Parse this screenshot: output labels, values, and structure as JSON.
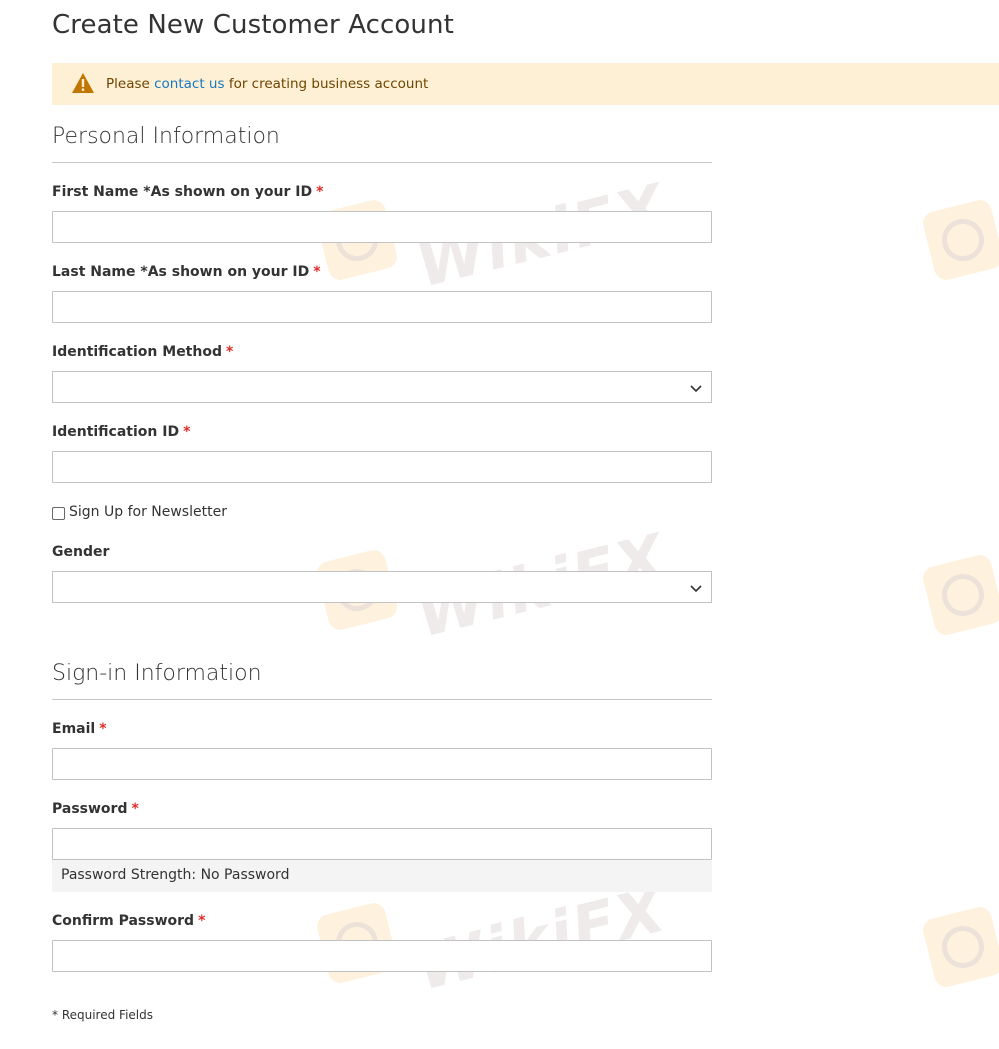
{
  "page": {
    "title": "Create New Customer Account"
  },
  "notice": {
    "prefix": "Please",
    "link": "contact us",
    "suffix": "for creating business account"
  },
  "personal": {
    "heading": "Personal Information",
    "first_name_label": "First Name *As shown on your ID",
    "last_name_label": "Last Name *As shown on your ID",
    "id_method_label": "Identification Method",
    "id_label": "Identification ID",
    "newsletter_label": "Sign Up for Newsletter",
    "gender_label": "Gender"
  },
  "signin": {
    "heading": "Sign-in Information",
    "email_label": "Email",
    "password_label": "Password",
    "password_strength": "Password Strength: No Password",
    "confirm_label": "Confirm Password"
  },
  "required_marker": "*",
  "required_note": "* Required Fields",
  "watermark": "WikiFX",
  "colors": {
    "required": "#e02b27",
    "link": "#1979c3",
    "notice_bg": "#fdf0d5",
    "warning_icon": "#c07600"
  }
}
